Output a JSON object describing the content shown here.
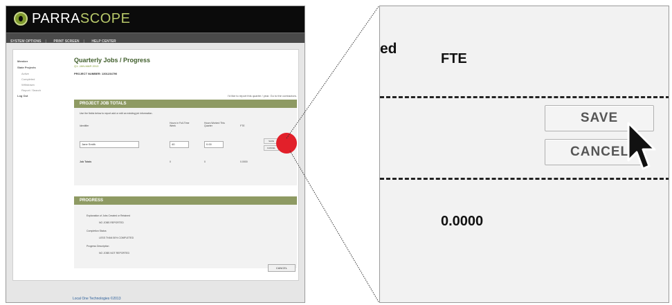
{
  "brand": {
    "prefix": "PARRA",
    "suffix": "SCOPE"
  },
  "nav": {
    "items": [
      "SYSTEM OPTIONS",
      "PRINT SCREEN",
      "HELP CENTER"
    ]
  },
  "sidebar": {
    "items": [
      {
        "label": "Member"
      },
      {
        "label": "State Projects"
      },
      {
        "label": "Active",
        "sub": true
      },
      {
        "label": "Completed",
        "sub": true
      },
      {
        "label": "Withdrawn",
        "sub": true
      },
      {
        "label": "Report / Search",
        "sub": true
      },
      {
        "label": "Log Out"
      }
    ]
  },
  "page": {
    "title": "Quarterly Jobs / Progress",
    "subtitle": "Q1: JAN-MAR 2013",
    "project_label": "PROJECT NUMBER: 1301234790",
    "note": "I'd like to report this quarter / year. Go to the contractors."
  },
  "jobs_section": {
    "title": "PROJECT JOB TOTALS",
    "instruction": "Use the fields below to report add or edit an existing job information.",
    "columns": [
      "Identifier",
      "Hours in Full-Time Week",
      "Hours Worked This Quarter",
      "FTE"
    ],
    "row": {
      "identifier": "Jane Smith",
      "hours_week": "40",
      "hours_worked": "0.00"
    },
    "mini_buttons": [
      "SAVE",
      "CANCEL"
    ],
    "totals": {
      "label": "Job Totals",
      "a": "0",
      "b": "0",
      "fte": "0.0000"
    }
  },
  "progress_section": {
    "title": "PROGRESS",
    "lines": [
      "Explanation of Jobs Created or Retained",
      "NO JOBS REPORTED",
      "Completion Status",
      "LESS THAN 50% COMPLETED",
      "Progress Description",
      "NO JOBS NOT REPORTED"
    ]
  },
  "exit_label": "CANCEL",
  "footer": "Local One Technologies ©2013",
  "zoom": {
    "partial_text": "ed",
    "fte_label": "FTE",
    "save_label": "SAVE",
    "cancel_label": "CANCEL",
    "total_value": "0.0000"
  },
  "colors": {
    "accent": "#8e9a63",
    "marker": "#e2202a",
    "header": "#0b0b0b"
  }
}
